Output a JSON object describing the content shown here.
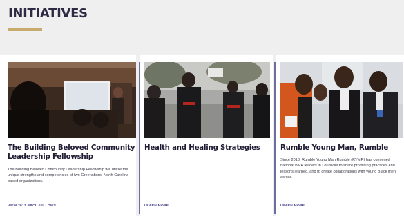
{
  "section": {
    "heading": "INITIATIVES",
    "accent_color": "#c7ab6c",
    "divider_color": "#6c6f9e"
  },
  "cards": [
    {
      "photo_subject": "people seated facing a projection screen in a dim room",
      "title": "The Building Beloved Community Leadership Fellowship",
      "description": "The Building Beloved Community Leadership Fellowship will utilize the unique strengths and competencies of two Greensboro, North Carolina based organizations.",
      "link": "VIEW 2017 BBCL FELLOWS"
    },
    {
      "photo_subject": "group of men walking outdoors wearing dark hoodies",
      "title": "Health and Healing Strategies",
      "description": "",
      "link": "LEARN MORE"
    },
    {
      "photo_subject": "four smiling men posing together in front of a window",
      "title": "Rumble Young Man, Rumble",
      "description": "Since 2010, Rumble Young Man Rumble (RYMR) has convened national BMA leaders in Louisville to share promising practices and lessons learned, and to create collaborations with young Black men across",
      "link": "LEARN MORE"
    }
  ]
}
